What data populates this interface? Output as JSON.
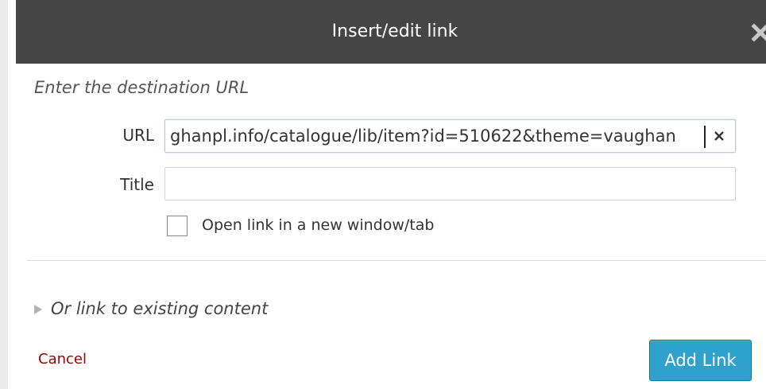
{
  "dialog": {
    "title": "Insert/edit link",
    "close_icon": "close-icon"
  },
  "form": {
    "instruction": "Enter the destination URL",
    "url_label": "URL",
    "url_value": "ghanpl.info/catalogue/lib/item?id=510622&theme=vaughan",
    "title_label": "Title",
    "title_value": "",
    "new_tab_label": "Open link in a new window/tab",
    "new_tab_checked": false
  },
  "existing": {
    "label": "Or link to existing content",
    "icon": "triangle-right-icon"
  },
  "actions": {
    "cancel_label": "Cancel",
    "add_label": "Add Link"
  },
  "colors": {
    "titlebar": "#454545",
    "primary": "#2ea2cc",
    "cancel": "#a00000"
  }
}
